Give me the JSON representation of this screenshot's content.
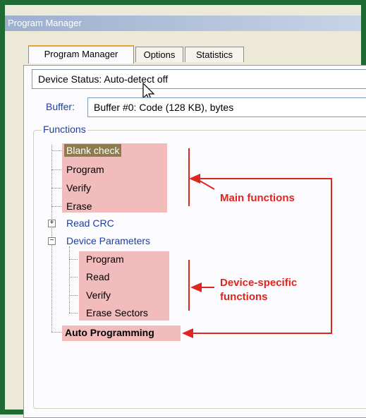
{
  "window": {
    "title": "Program Manager"
  },
  "tabs": [
    {
      "label": "Program Manager",
      "active": true
    },
    {
      "label": "Options",
      "active": false
    },
    {
      "label": "Statistics",
      "active": false
    }
  ],
  "device_status": "Device Status: Auto-detect off",
  "buffer": {
    "label": "Buffer:",
    "value": "Buffer #0:  Code (128 KB), bytes"
  },
  "functions": {
    "title": "Functions",
    "main": [
      "Blank check",
      "Program",
      "Verify",
      "Erase"
    ],
    "read_crc": "Read CRC",
    "device_parameters": {
      "label": "Device Parameters",
      "children": [
        "Program",
        "Read",
        "Verify",
        "Erase Sectors"
      ]
    },
    "auto_programming": "Auto Programming"
  },
  "annotations": {
    "main": "Main functions",
    "device_specific_line1": "Device-specific",
    "device_specific_line2": "functions",
    "color": "#e0241f"
  },
  "colors": {
    "frame": "#1f6b33",
    "highlight_fill": "#f3bcbc",
    "tab_accent": "#e6a238"
  }
}
